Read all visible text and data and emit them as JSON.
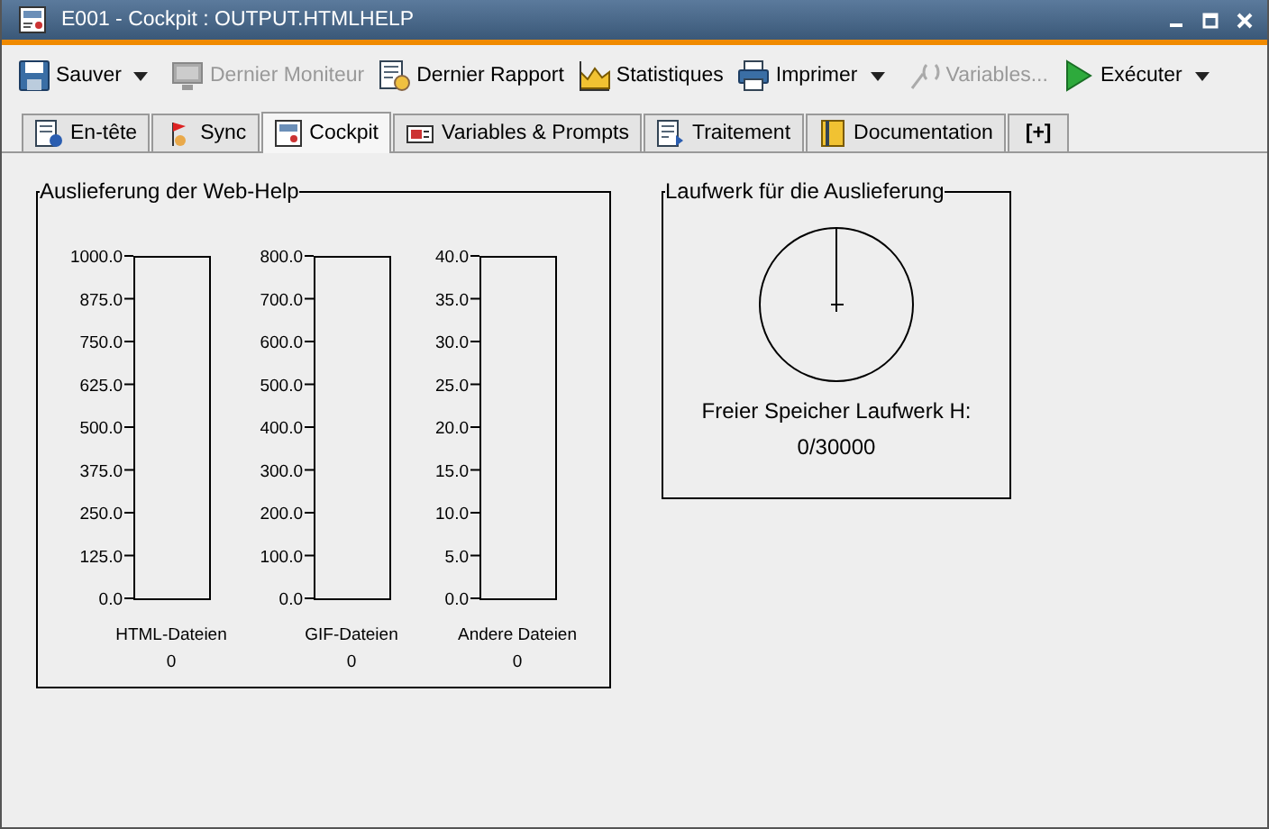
{
  "window": {
    "title": "E001 - Cockpit : OUTPUT.HTMLHELP"
  },
  "toolbar": [
    {
      "label": "Sauver",
      "disabled": false,
      "dropdown": true
    },
    {
      "label": "Dernier Moniteur",
      "disabled": true,
      "dropdown": false
    },
    {
      "label": "Dernier Rapport",
      "disabled": false,
      "dropdown": false
    },
    {
      "label": "Statistiques",
      "disabled": false,
      "dropdown": false
    },
    {
      "label": "Imprimer",
      "disabled": false,
      "dropdown": true
    },
    {
      "label": "Variables...",
      "disabled": true,
      "dropdown": false
    },
    {
      "label": "Exécuter",
      "disabled": false,
      "dropdown": true
    }
  ],
  "tabs": [
    {
      "label": "En-tête",
      "selected": false
    },
    {
      "label": "Sync",
      "selected": false
    },
    {
      "label": "Cockpit",
      "selected": true
    },
    {
      "label": "Variables & Prompts",
      "selected": false
    },
    {
      "label": "Traitement",
      "selected": false
    },
    {
      "label": "Documentation",
      "selected": false
    },
    {
      "label": "[+]",
      "selected": false
    }
  ],
  "delivery_panel": {
    "title": "Auslieferung der Web-Help",
    "gauges": [
      {
        "count": "0",
        "chart_data": {
          "type": "bar",
          "categories": [
            "HTML-Dateien"
          ],
          "values": [
            0
          ],
          "ylim": [
            0,
            1000
          ],
          "yticks": [
            {
              "value": 0,
              "label": "0.0"
            },
            {
              "value": 125,
              "label": "125.0"
            },
            {
              "value": 250,
              "label": "250.0"
            },
            {
              "value": 375,
              "label": "375.0"
            },
            {
              "value": 500,
              "label": "500.0"
            },
            {
              "value": 625,
              "label": "625.0"
            },
            {
              "value": 750,
              "label": "750.0"
            },
            {
              "value": 875,
              "label": "875.0"
            },
            {
              "value": 1000,
              "label": "1000.0"
            }
          ]
        }
      },
      {
        "count": "0",
        "chart_data": {
          "type": "bar",
          "categories": [
            "GIF-Dateien"
          ],
          "values": [
            0
          ],
          "ylim": [
            0,
            800
          ],
          "yticks": [
            {
              "value": 0,
              "label": "0.0"
            },
            {
              "value": 100,
              "label": "100.0"
            },
            {
              "value": 200,
              "label": "200.0"
            },
            {
              "value": 300,
              "label": "300.0"
            },
            {
              "value": 400,
              "label": "400.0"
            },
            {
              "value": 500,
              "label": "500.0"
            },
            {
              "value": 600,
              "label": "600.0"
            },
            {
              "value": 700,
              "label": "700.0"
            },
            {
              "value": 800,
              "label": "800.0"
            }
          ]
        }
      },
      {
        "count": "0",
        "chart_data": {
          "type": "bar",
          "categories": [
            "Andere Dateien"
          ],
          "values": [
            0
          ],
          "ylim": [
            0,
            40
          ],
          "yticks": [
            {
              "value": 0,
              "label": "0.0"
            },
            {
              "value": 5,
              "label": "5.0"
            },
            {
              "value": 10,
              "label": "10.0"
            },
            {
              "value": 15,
              "label": "15.0"
            },
            {
              "value": 20,
              "label": "20.0"
            },
            {
              "value": 25,
              "label": "25.0"
            },
            {
              "value": 30,
              "label": "30.0"
            },
            {
              "value": 35,
              "label": "35.0"
            },
            {
              "value": 40,
              "label": "40.0"
            }
          ]
        }
      }
    ]
  },
  "drive_panel": {
    "title": "Laufwerk für die Auslieferung",
    "label": "Freier Speicher Laufwerk H:",
    "reading": "0/30000"
  }
}
